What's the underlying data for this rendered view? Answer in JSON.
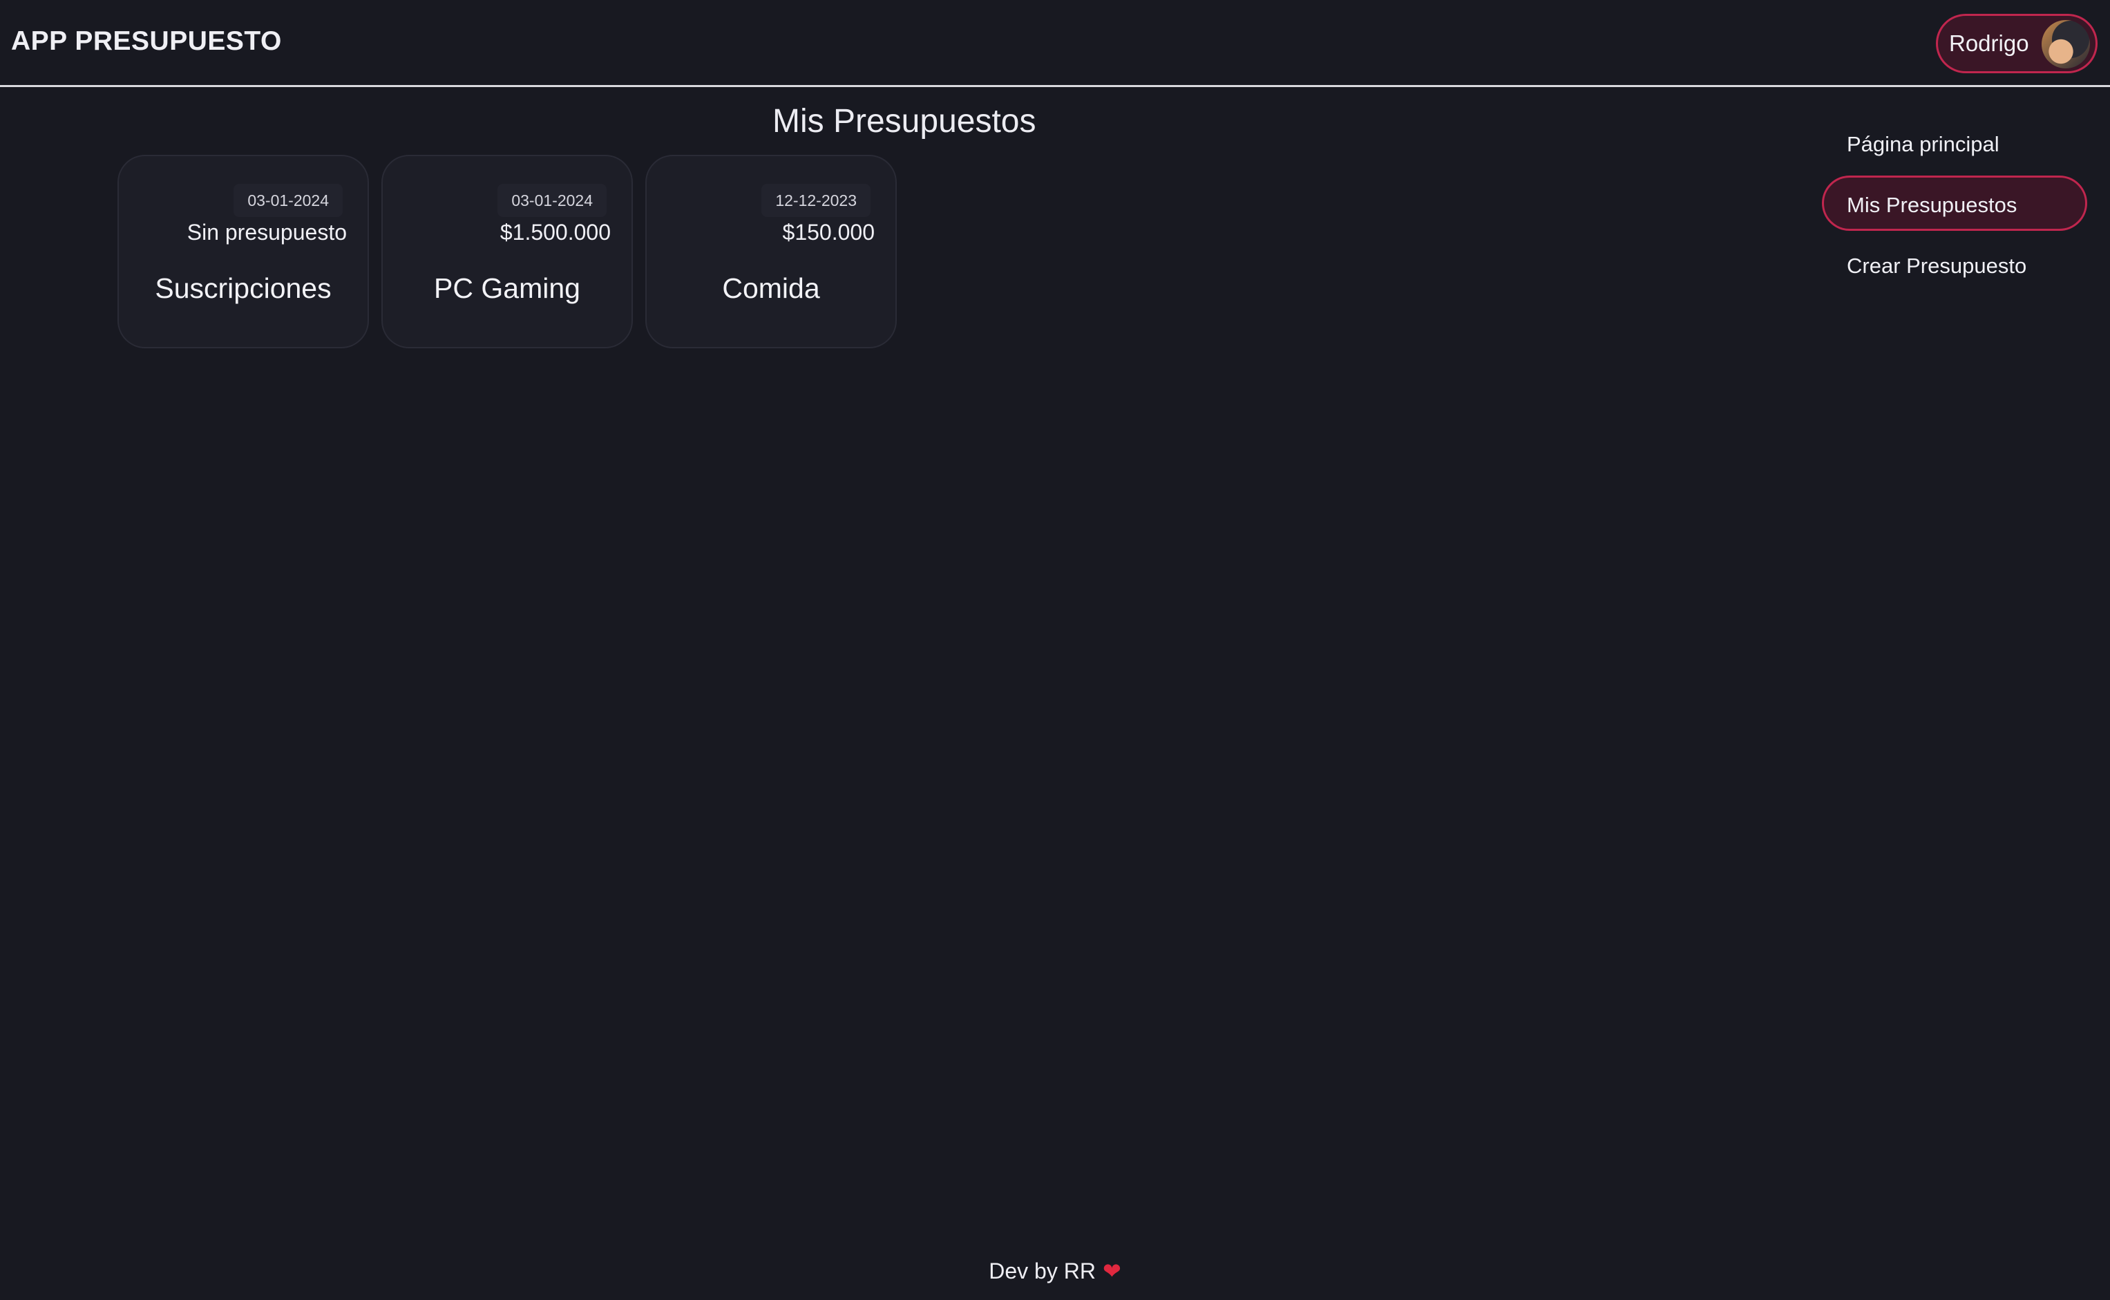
{
  "header": {
    "app_title": "APP PRESUPUESTO",
    "user_name": "Rodrigo"
  },
  "main": {
    "title": "Mis Presupuestos",
    "cards": [
      {
        "date": "03-01-2024",
        "amount": "Sin presupuesto",
        "name": "Suscripciones"
      },
      {
        "date": "03-01-2024",
        "amount": "$1.500.000",
        "name": "PC Gaming"
      },
      {
        "date": "12-12-2023",
        "amount": "$150.000",
        "name": "Comida"
      }
    ]
  },
  "sidebar": {
    "items": [
      {
        "label": "Página principal",
        "active": false
      },
      {
        "label": "Mis Presupuestos",
        "active": true
      },
      {
        "label": "Crear Presupuesto",
        "active": false
      }
    ]
  },
  "footer": {
    "text": "Dev by RR",
    "icon": "heart-icon"
  },
  "colors": {
    "background": "#181921",
    "accent": "#c0264e",
    "accent_bg": "#3a1626",
    "heart": "#e0283f"
  }
}
